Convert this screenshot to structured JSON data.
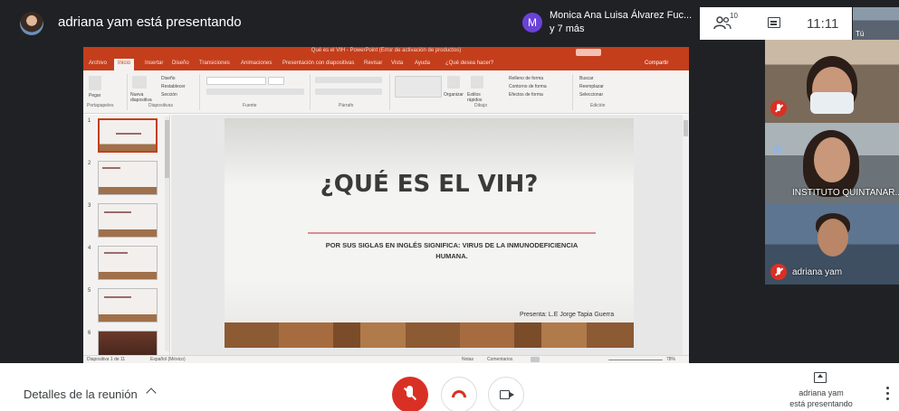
{
  "topbar": {
    "presenting_title": "adriana yam está presentando",
    "participant_initial": "M",
    "participant_name": "Monica Ana Luisa Álvarez Fuc...",
    "participant_more": "y 7 más",
    "people_count": "10",
    "clock": "11:11",
    "self_label": "Tú"
  },
  "powerpoint": {
    "window_title": "Qué es el VIH - PowerPoint (Error de activación de productos)",
    "signin": "Iniciar sesión",
    "share": "Compartir",
    "tabs": [
      "Archivo",
      "Inicio",
      "Insertar",
      "Diseño",
      "Transiciones",
      "Animaciones",
      "Presentación con diapositivas",
      "Revisar",
      "Vista",
      "Ayuda",
      "¿Qué desea hacer?"
    ],
    "ribbon_groups": [
      "Portapapeles",
      "Diapositivas",
      "Fuente",
      "Párrafo",
      "Dibujo",
      "Edición"
    ],
    "ribbon_items": {
      "paste": "Pegar",
      "new_slide": "Nueva diapositiva",
      "layout": "Diseño",
      "reset": "Restablecer",
      "section": "Sección",
      "arrange": "Organizar",
      "quick_styles": "Estilos rápidos",
      "fill": "Relleno de forma",
      "outline": "Contorno de forma",
      "effects": "Efectos de forma",
      "find": "Buscar",
      "replace": "Reemplazar",
      "select": "Seleccionar"
    },
    "thumbnails": [
      "1",
      "2",
      "3",
      "4",
      "5",
      "6"
    ],
    "slide": {
      "title": "¿QUÉ ES EL VIH?",
      "subtitle": "POR SUS SIGLAS EN INGLÉS SIGNIFICA: VIRUS DE LA INMUNODEFICIENCIA HUMANA.",
      "author": "Presenta: L.E Jorge Tapia Guerra"
    },
    "status": {
      "slide_count": "Diapositiva 1 de 11",
      "language": "Español (México)",
      "notes": "Notas",
      "comments": "Comentarios",
      "zoom": "78%"
    }
  },
  "tiles": [
    {
      "name": ""
    },
    {
      "name": "INSTITUTO QUINTANAR..."
    },
    {
      "name": "adriana yam"
    }
  ],
  "bottombar": {
    "meeting_details": "Detalles de la reunión",
    "presenter_name": "adriana yam",
    "presenting_status": "está presentando"
  },
  "colors": {
    "ppt_accent": "#c43e1c",
    "mute_red": "#d93025",
    "badge_purple": "#6a42d8"
  }
}
